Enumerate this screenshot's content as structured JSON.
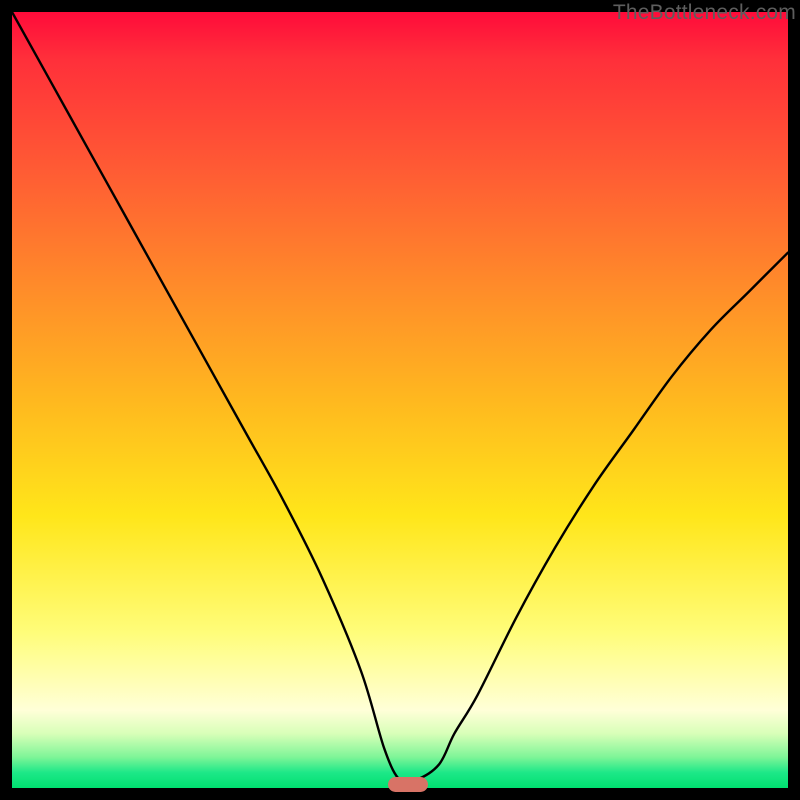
{
  "watermark": "TheBottleneck.com",
  "chart_data": {
    "type": "line",
    "title": "",
    "xlabel": "",
    "ylabel": "",
    "xlim": [
      0,
      100
    ],
    "ylim": [
      0,
      100
    ],
    "grid": false,
    "legend": false,
    "series": [
      {
        "name": "bottleneck-curve",
        "x": [
          0,
          5,
          10,
          15,
          20,
          25,
          30,
          35,
          40,
          45,
          48,
          50,
          52,
          55,
          57,
          60,
          65,
          70,
          75,
          80,
          85,
          90,
          95,
          100
        ],
        "values": [
          100,
          91,
          82,
          73,
          64,
          55,
          46,
          37,
          27,
          15,
          5,
          1,
          1,
          3,
          7,
          12,
          22,
          31,
          39,
          46,
          53,
          59,
          64,
          69
        ]
      }
    ],
    "annotations": [
      {
        "name": "optimal-marker",
        "x": 51,
        "y": 0.5
      }
    ],
    "background_gradient": {
      "top": "#ff0b3a",
      "mid_upper": "#ff8a2a",
      "mid": "#ffe61a",
      "mid_lower": "#ffffd8",
      "bottom": "#00e070"
    }
  }
}
